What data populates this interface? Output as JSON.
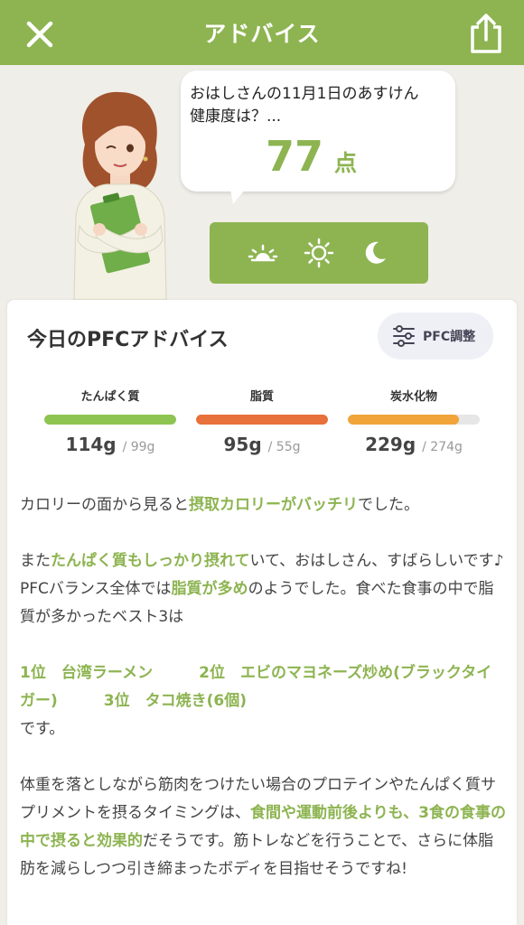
{
  "header": {
    "title": "アドバイス"
  },
  "bubble": {
    "line1": "おはしさんの11月1日のあすけん",
    "line2": "健康度は？...",
    "score": "77",
    "score_unit": "点"
  },
  "time_bar": {
    "icons": [
      "sunrise-icon",
      "sun-icon",
      "moon-icon"
    ]
  },
  "card": {
    "title": "今日のPFCアドバイス",
    "pfc_button": "PFC調整"
  },
  "macros": [
    {
      "label": "たんぱく質",
      "value": "114g",
      "target": "/ 99g",
      "progress": 1.0,
      "color": "#8ec451"
    },
    {
      "label": "脂質",
      "value": "95g",
      "target": "/ 55g",
      "progress": 1.0,
      "color": "#e8703a"
    },
    {
      "label": "炭水化物",
      "value": "229g",
      "target": "/ 274g",
      "progress": 0.84,
      "color": "#f0a43a"
    }
  ],
  "advice": {
    "p1_a": "カロリーの面から見ると",
    "p1_b": "摂取カロリーがバッチリ",
    "p1_c": "でした。",
    "p2_a": "また",
    "p2_b": "たんぱく質もしっかり摂れて",
    "p2_c": "いて、おはしさん、すばらしいです♪",
    "p3_a": "PFCバランス全体では",
    "p3_b": "脂質が多め",
    "p3_c": "のようでした。食べた食事の中で脂質が多かったベスト3は",
    "p4_a": "1位　台湾ラーメン　　　2位　エビのマヨネーズ炒め(ブラックタイガー)　　　3位　タコ焼き(6個)",
    "p4_b": "です。",
    "p5_a": "体重を落としながら筋肉をつけたい場合のプロテインやたんぱく質サプリメントを摂るタイミングは、",
    "p5_b": "食間や運動前後よりも、3食の食事の中で摂ると効果的",
    "p5_c": "だそうです。筋トレなどを行うことで、さらに体脂肪を減らしつつ引き締まったボディを目指せそうですね!"
  },
  "colors": {
    "accent": "#8db451",
    "background": "#f0eee8"
  }
}
